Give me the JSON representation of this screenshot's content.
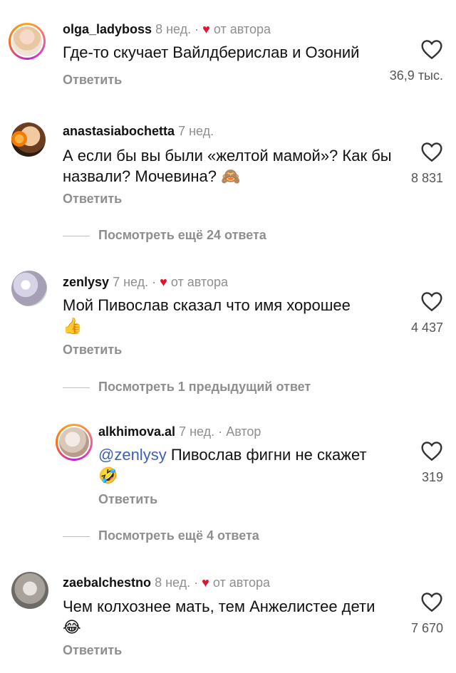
{
  "comments": [
    {
      "user": "olga_ladyboss",
      "time": "8 нед.",
      "author_tag": "от автора",
      "text": "Где-то скучает Вайлдберислав и Озоний",
      "reply": "Ответить",
      "likes": "36,9 тыс."
    },
    {
      "user": "anastasiabochetta",
      "time": "7 нед.",
      "text": "А если бы вы были «желтой мамой»? Как бы назвали? Мочевина?",
      "emoji": "🙈",
      "reply": "Ответить",
      "likes": "8 831",
      "more": "Посмотреть ещё 24 ответа"
    },
    {
      "user": "zenlysy",
      "time": "7 нед.",
      "author_tag": "от автора",
      "text": "Мой Пивослав сказал что имя хорошее",
      "emoji": "👍",
      "reply": "Ответить",
      "likes": "4 437",
      "more": "Посмотреть 1 предыдущий ответ"
    },
    {
      "user": "alkhimova.al",
      "time": "7 нед.",
      "author_badge": "Автор",
      "mention": "@zenlysy",
      "text": "Пивослав фигни не скажет",
      "emoji": "🤣",
      "reply": "Ответить",
      "likes": "319",
      "more": "Посмотреть ещё 4 ответа"
    },
    {
      "user": "zaebalchestno",
      "time": "8 нед.",
      "author_tag": "от автора",
      "text": "Чем колхознее мать, тем Анжелистее дети",
      "emoji": "😂",
      "reply": "Ответить",
      "likes": "7 670"
    }
  ],
  "separator": "·",
  "colors": {
    "accent_heart": "#e0142e",
    "mention": "#3e5fb7",
    "muted": "#8e8e8e"
  }
}
